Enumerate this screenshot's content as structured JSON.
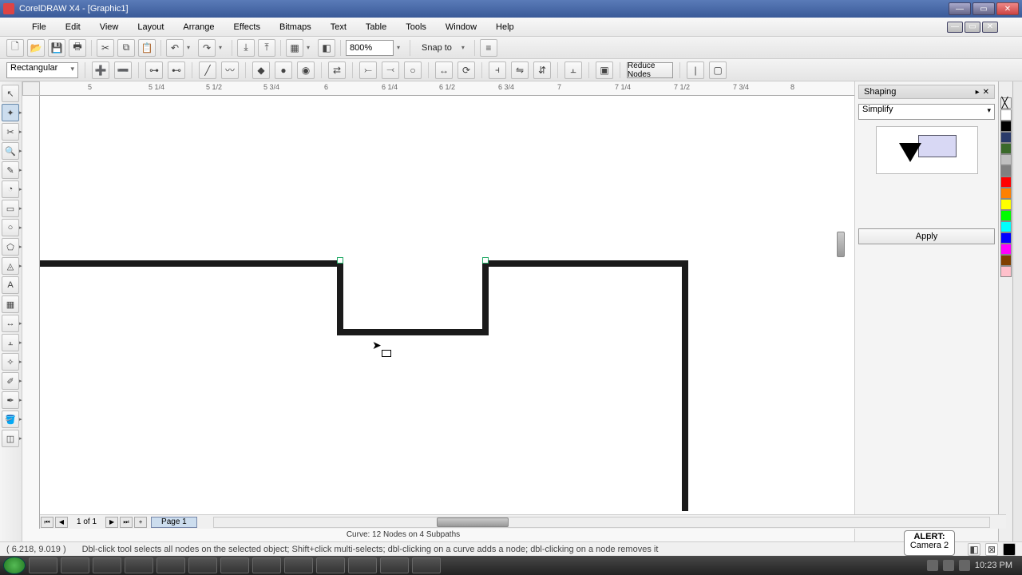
{
  "window": {
    "title": "CorelDRAW X4 - [Graphic1]"
  },
  "menu": [
    "File",
    "Edit",
    "View",
    "Layout",
    "Arrange",
    "Effects",
    "Bitmaps",
    "Text",
    "Table",
    "Tools",
    "Window",
    "Help"
  ],
  "toolbar": {
    "zoom": "800%",
    "snap_label": "Snap to"
  },
  "propbar": {
    "shape_mode": "Rectangular",
    "btn": "Reduce Nodes"
  },
  "ruler": {
    "units": "inches",
    "ticks": [
      "5",
      "5 1/4",
      "5 1/2",
      "5 3/4",
      "6",
      "6 1/4",
      "6 1/2",
      "6 3/4",
      "7",
      "7 1/4",
      "7 1/2",
      "7 3/4",
      "8"
    ]
  },
  "docker": {
    "title": "Shaping",
    "mode": "Simplify",
    "apply": "Apply"
  },
  "page": {
    "counter": "1 of 1",
    "tab": "Page 1"
  },
  "status": {
    "object_info": "Curve: 12 Nodes on 4 Subpaths",
    "coords": "( 6.218, 9.019 )",
    "hint": "Dbl-click tool selects all nodes on the selected object; Shift+click multi-selects; dbl-clicking on a curve adds a node; dbl-clicking on a node removes it"
  },
  "alert": {
    "title": "ALERT:",
    "line": "Camera 2"
  },
  "tray": {
    "clock": "10:23 PM"
  },
  "palette": [
    "#ffffff",
    "#000000",
    "#2a3b6a",
    "#3a6a2a",
    "#c0c0c0",
    "#808080",
    "#ff0000",
    "#ff8000",
    "#ffff00",
    "#00ff00",
    "#00ffff",
    "#0000ff",
    "#ff00ff",
    "#804000",
    "#ffc0cb"
  ]
}
